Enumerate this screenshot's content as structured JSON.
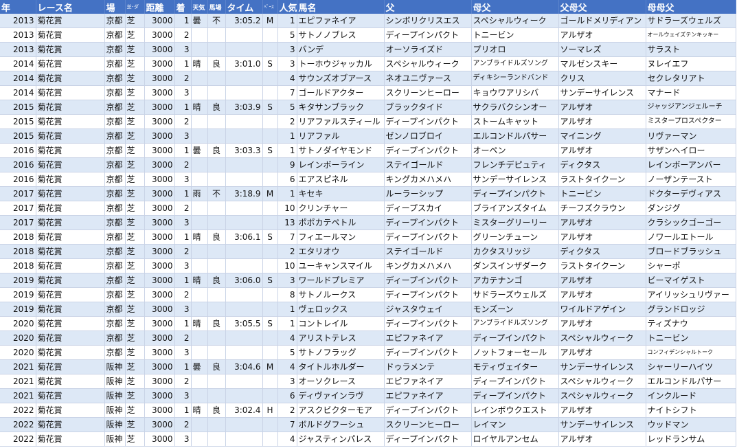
{
  "headers": [
    "年",
    "レース名",
    "場",
    "芝･ダ",
    "距離",
    "着",
    "天気",
    "馬場",
    "タイム",
    "ﾍﾟｰｽ",
    "人気",
    "馬名",
    "父",
    "母父",
    "父母父",
    "母母父"
  ],
  "rows": [
    [
      "2013",
      "菊花賞",
      "京都",
      "芝",
      "3000",
      "1",
      "曇",
      "不",
      "3:05.2",
      "M",
      "1",
      "エピファネイア",
      "シンボリクリスエス",
      "スペシャルウィーク",
      "ゴールドメリディアン",
      "サドラーズウェルズ"
    ],
    [
      "2013",
      "菊花賞",
      "京都",
      "芝",
      "3000",
      "2",
      "",
      "",
      "",
      "",
      "5",
      "サトノノブレス",
      "ディープインパクト",
      "トニービン",
      "アルザオ",
      "オールウェイズテンキッキー"
    ],
    [
      "2013",
      "菊花賞",
      "京都",
      "芝",
      "3000",
      "3",
      "",
      "",
      "",
      "",
      "3",
      "バンデ",
      "オーソライズド",
      "プリオロ",
      "ソーマレズ",
      "サラスト"
    ],
    [
      "2014",
      "菊花賞",
      "京都",
      "芝",
      "3000",
      "1",
      "晴",
      "良",
      "3:01.0",
      "S",
      "3",
      "トーホウジャッカル",
      "スペシャルウィーク",
      "アンブライドルズソング",
      "マルゼンスキー",
      "ヌレイエフ"
    ],
    [
      "2014",
      "菊花賞",
      "京都",
      "芝",
      "3000",
      "2",
      "",
      "",
      "",
      "",
      "4",
      "サウンズオブアース",
      "ネオユニヴァース",
      "ディキシーランドバンド",
      "クリス",
      "セクレタリアト"
    ],
    [
      "2014",
      "菊花賞",
      "京都",
      "芝",
      "3000",
      "3",
      "",
      "",
      "",
      "",
      "7",
      "ゴールドアクター",
      "スクリーンヒーロー",
      "キョウワアリシバ",
      "サンデーサイレンス",
      "マナード"
    ],
    [
      "2015",
      "菊花賞",
      "京都",
      "芝",
      "3000",
      "1",
      "晴",
      "良",
      "3:03.9",
      "S",
      "5",
      "キタサンブラック",
      "ブラックタイド",
      "サクラバクシンオー",
      "アルザオ",
      "ジャッジアンジェルーチ"
    ],
    [
      "2015",
      "菊花賞",
      "京都",
      "芝",
      "3000",
      "2",
      "",
      "",
      "",
      "",
      "2",
      "リアファルスティール",
      "ディープインパクト",
      "ストームキャット",
      "アルザオ",
      "ミスタープロスペクター"
    ],
    [
      "2015",
      "菊花賞",
      "京都",
      "芝",
      "3000",
      "3",
      "",
      "",
      "",
      "",
      "1",
      "リアファル",
      "ゼンノロブロイ",
      "エルコンドルパサー",
      "マイニング",
      "リヴァーマン"
    ],
    [
      "2016",
      "菊花賞",
      "京都",
      "芝",
      "3000",
      "1",
      "曇",
      "良",
      "3:03.3",
      "S",
      "1",
      "サトノダイヤモンド",
      "ディープインパクト",
      "オーペン",
      "アルザオ",
      "サザンヘイロー"
    ],
    [
      "2016",
      "菊花賞",
      "京都",
      "芝",
      "3000",
      "2",
      "",
      "",
      "",
      "",
      "9",
      "レインボーライン",
      "ステイゴールド",
      "フレンチデピュティ",
      "ディクタス",
      "レインボーアンバー"
    ],
    [
      "2016",
      "菊花賞",
      "京都",
      "芝",
      "3000",
      "3",
      "",
      "",
      "",
      "",
      "6",
      "エアスピネル",
      "キングカメハメハ",
      "サンデーサイレンス",
      "ラストタイクーン",
      "ノーザンテースト"
    ],
    [
      "2017",
      "菊花賞",
      "京都",
      "芝",
      "3000",
      "1",
      "雨",
      "不",
      "3:18.9",
      "M",
      "1",
      "キセキ",
      "ルーラーシップ",
      "ディープインパクト",
      "トニービン",
      "ドクターデヴィアス"
    ],
    [
      "2017",
      "菊花賞",
      "京都",
      "芝",
      "3000",
      "2",
      "",
      "",
      "",
      "",
      "10",
      "クリンチャー",
      "ディープスカイ",
      "ブライアンズタイム",
      "チーフズクラウン",
      "ダンジグ"
    ],
    [
      "2017",
      "菊花賞",
      "京都",
      "芝",
      "3000",
      "3",
      "",
      "",
      "",
      "",
      "13",
      "ポポカテペトル",
      "ディープインパクト",
      "ミスターグリーリー",
      "アルザオ",
      "クラシックゴーゴー"
    ],
    [
      "2018",
      "菊花賞",
      "京都",
      "芝",
      "3000",
      "1",
      "晴",
      "良",
      "3:06.1",
      "S",
      "7",
      "フィエールマン",
      "ディープインパクト",
      "グリーンチューン",
      "アルザオ",
      "ノワールエトール"
    ],
    [
      "2018",
      "菊花賞",
      "京都",
      "芝",
      "3000",
      "2",
      "",
      "",
      "",
      "",
      "2",
      "エタリオウ",
      "ステイゴールド",
      "カクタスリッジ",
      "ディクタス",
      "ブロードブラッシュ"
    ],
    [
      "2018",
      "菊花賞",
      "京都",
      "芝",
      "3000",
      "3",
      "",
      "",
      "",
      "",
      "10",
      "ユーキャンスマイル",
      "キングカメハメハ",
      "ダンスインザダーク",
      "ラストタイクーン",
      "シャーポ"
    ],
    [
      "2019",
      "菊花賞",
      "京都",
      "芝",
      "3000",
      "1",
      "晴",
      "良",
      "3:06.0",
      "S",
      "3",
      "ワールドプレミア",
      "ディープインパクト",
      "アカテナンゴ",
      "アルザオ",
      "ビーマイゲスト"
    ],
    [
      "2019",
      "菊花賞",
      "京都",
      "芝",
      "3000",
      "2",
      "",
      "",
      "",
      "",
      "8",
      "サトノルークス",
      "ディープインパクト",
      "サドラーズウェルズ",
      "アルザオ",
      "アイリッシュリヴァー"
    ],
    [
      "2019",
      "菊花賞",
      "京都",
      "芝",
      "3000",
      "3",
      "",
      "",
      "",
      "",
      "1",
      "ヴェロックス",
      "ジャスタウェイ",
      "モンズーン",
      "ワイルドアゲイン",
      "グランドロッジ"
    ],
    [
      "2020",
      "菊花賞",
      "京都",
      "芝",
      "3000",
      "1",
      "晴",
      "良",
      "3:05.5",
      "S",
      "1",
      "コントレイル",
      "ディープインパクト",
      "アンブライドルズソング",
      "アルザオ",
      "ティズナウ"
    ],
    [
      "2020",
      "菊花賞",
      "京都",
      "芝",
      "3000",
      "2",
      "",
      "",
      "",
      "",
      "4",
      "アリストテレス",
      "エピファネイア",
      "ディープインパクト",
      "スペシャルウィーク",
      "トニービン"
    ],
    [
      "2020",
      "菊花賞",
      "京都",
      "芝",
      "3000",
      "3",
      "",
      "",
      "",
      "",
      "5",
      "サトノフラッグ",
      "ディープインパクト",
      "ノットフォーセール",
      "アルザオ",
      "コンフィデンシャルトーク"
    ],
    [
      "2021",
      "菊花賞",
      "阪神",
      "芝",
      "3000",
      "1",
      "曇",
      "良",
      "3:04.6",
      "M",
      "4",
      "タイトルホルダー",
      "ドゥラメンテ",
      "モティヴェイター",
      "サンデーサイレンス",
      "シャーリーハイツ"
    ],
    [
      "2021",
      "菊花賞",
      "阪神",
      "芝",
      "3000",
      "2",
      "",
      "",
      "",
      "",
      "3",
      "オーソクレース",
      "エピファネイア",
      "ディープインパクト",
      "スペシャルウィーク",
      "エルコンドルパサー"
    ],
    [
      "2021",
      "菊花賞",
      "阪神",
      "芝",
      "3000",
      "3",
      "",
      "",
      "",
      "",
      "6",
      "ディヴァインラヴ",
      "エピファネイア",
      "ディープインパクト",
      "スペシャルウィーク",
      "インクルード"
    ],
    [
      "2022",
      "菊花賞",
      "阪神",
      "芝",
      "3000",
      "1",
      "晴",
      "良",
      "3:02.4",
      "H",
      "2",
      "アスクビクターモア",
      "ディープインパクト",
      "レインボウクエスト",
      "アルザオ",
      "ナイトシフト"
    ],
    [
      "2022",
      "菊花賞",
      "阪神",
      "芝",
      "3000",
      "2",
      "",
      "",
      "",
      "",
      "7",
      "ボルドグフーシュ",
      "スクリーンヒーロー",
      "レイマン",
      "サンデーサイレンス",
      "ウッドマン"
    ],
    [
      "2022",
      "菊花賞",
      "阪神",
      "芝",
      "3000",
      "3",
      "",
      "",
      "",
      "",
      "4",
      "ジャスティンパレス",
      "ディープインパクト",
      "ロイヤルアンセム",
      "アルザオ",
      "レッドランサム"
    ]
  ]
}
